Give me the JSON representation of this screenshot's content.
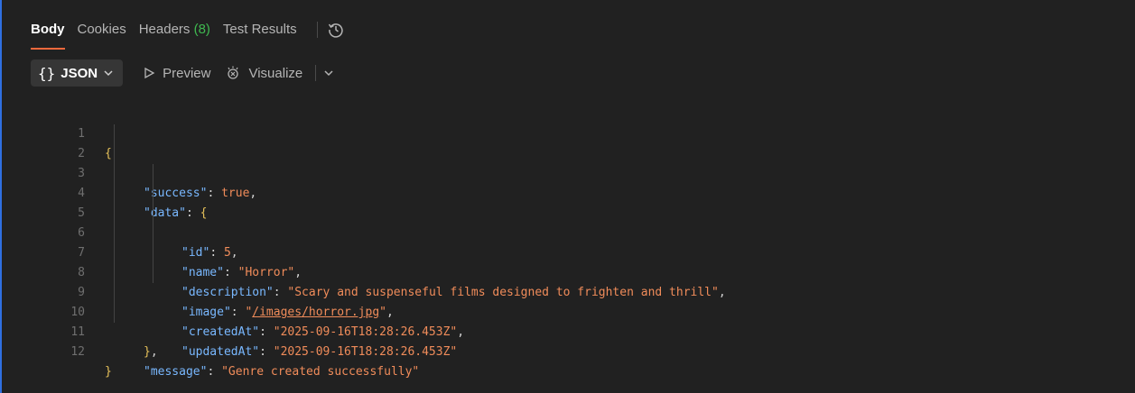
{
  "tabs": [
    {
      "label": "Body",
      "active": true
    },
    {
      "label": "Cookies",
      "active": false
    },
    {
      "label": "Headers",
      "count": "(8)",
      "active": false
    },
    {
      "label": "Test Results",
      "active": false
    }
  ],
  "toolbar": {
    "format_label": "JSON",
    "preview_label": "Preview",
    "visualize_label": "Visualize"
  },
  "colors": {
    "active_underline": "#f2683c",
    "header_count": "#3fb950",
    "key": "#79b8ff",
    "value": "#f08c5a",
    "brace": "#e6c15a"
  },
  "code": {
    "line_numbers": [
      "1",
      "2",
      "3",
      "4",
      "5",
      "6",
      "7",
      "8",
      "9",
      "10",
      "11",
      "12"
    ],
    "success_key": "\"success\"",
    "success_value": "true",
    "data_key": "\"data\"",
    "id_key": "\"id\"",
    "id_value": "5",
    "name_key": "\"name\"",
    "name_value": "\"Horror\"",
    "description_key": "\"description\"",
    "description_value": "\"Scary and suspenseful films designed to frighten and thrill\"",
    "image_key": "\"image\"",
    "image_value": "/images/horror.jpg",
    "createdAt_key": "\"createdAt\"",
    "createdAt_value": "\"2025-09-16T18:28:26.453Z\"",
    "updatedAt_key": "\"updatedAt\"",
    "updatedAt_value": "\"2025-09-16T18:28:26.453Z\"",
    "message_key": "\"message\"",
    "message_value": "\"Genre created successfully\""
  }
}
